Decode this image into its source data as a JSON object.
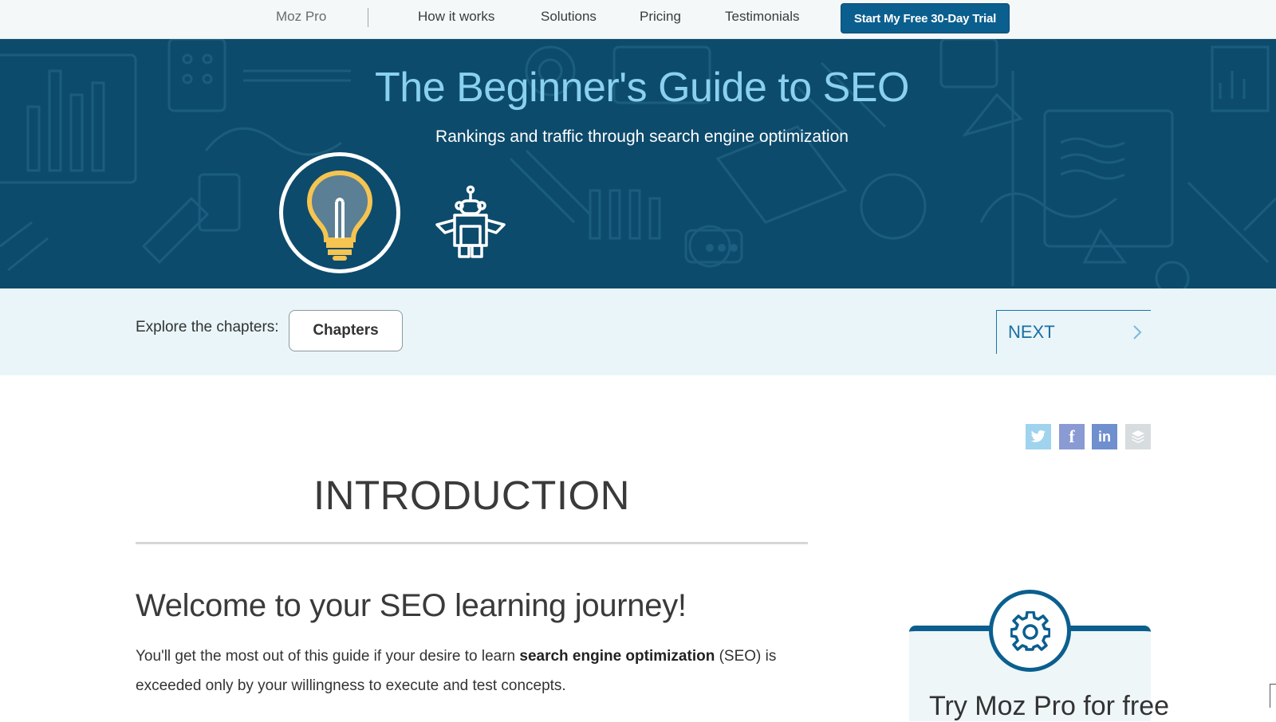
{
  "nav": {
    "brand": "Moz Pro",
    "links": [
      "How it works",
      "Solutions",
      "Pricing",
      "Testimonials"
    ],
    "cta": "Start My Free 30-Day Trial"
  },
  "hero": {
    "title": "The Beginner's Guide to SEO",
    "subtitle": "Rankings and traffic through search engine optimization"
  },
  "chapters": {
    "explore_label": "Explore the chapters:",
    "button_label": "Chapters",
    "next_label": "NEXT"
  },
  "social": {
    "facebook_glyph": "f",
    "linkedin_glyph": "in"
  },
  "content": {
    "section_title": "INTRODUCTION",
    "heading": "Welcome to your SEO learning journey!",
    "para_part1": "You'll get the most out of this guide if your desire to learn ",
    "para_bold": "search engine optimization",
    "para_part2": " (SEO) is exceeded only by your willingness to execute and test concepts."
  },
  "sidebar": {
    "card_title": "Try Moz Pro for free"
  },
  "colors": {
    "brand_blue": "#0b5f8f",
    "hero_bg": "#0d4b6c",
    "hero_title": "#8ad1ef",
    "chapter_bar": "#e9f5f8",
    "bulb_yellow": "#f5c451"
  },
  "icons": [
    "lightbulb-icon",
    "robot-icon",
    "twitter-icon",
    "facebook-icon",
    "linkedin-icon",
    "buffer-icon",
    "gear-icon",
    "chevron-right-icon"
  ]
}
